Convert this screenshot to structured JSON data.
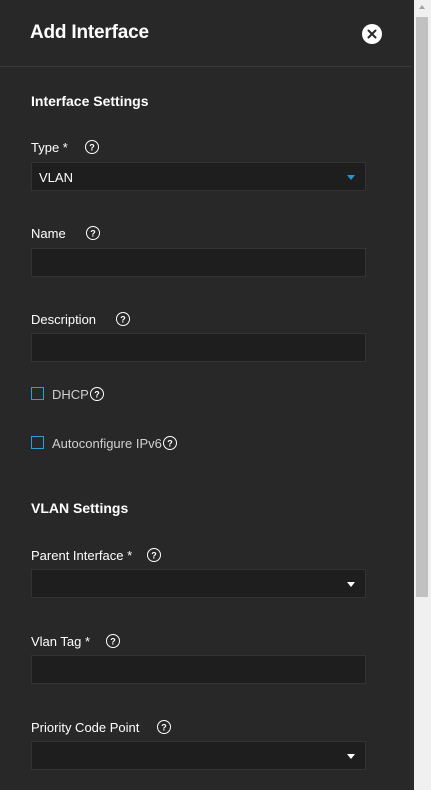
{
  "header": {
    "title": "Add Interface",
    "close_icon": "close-icon"
  },
  "interface_settings": {
    "section_title": "Interface Settings",
    "type": {
      "label": "Type *",
      "value": "VLAN",
      "accent": "#2196d3"
    },
    "name": {
      "label": "Name",
      "value": ""
    },
    "description": {
      "label": "Description",
      "value": ""
    },
    "dhcp": {
      "label": "DHCP",
      "checked": false
    },
    "autoconfigure_ipv6": {
      "label": "Autoconfigure IPv6",
      "checked": false
    }
  },
  "vlan_settings": {
    "section_title": "VLAN Settings",
    "parent_interface": {
      "label": "Parent Interface *",
      "value": ""
    },
    "vlan_tag": {
      "label": "Vlan Tag *",
      "value": ""
    },
    "priority_code_point": {
      "label": "Priority Code Point",
      "value": ""
    }
  },
  "colors": {
    "background": "#282828",
    "field_bg": "#1e1e1e",
    "checkbox_border": "#2b9fd9"
  }
}
